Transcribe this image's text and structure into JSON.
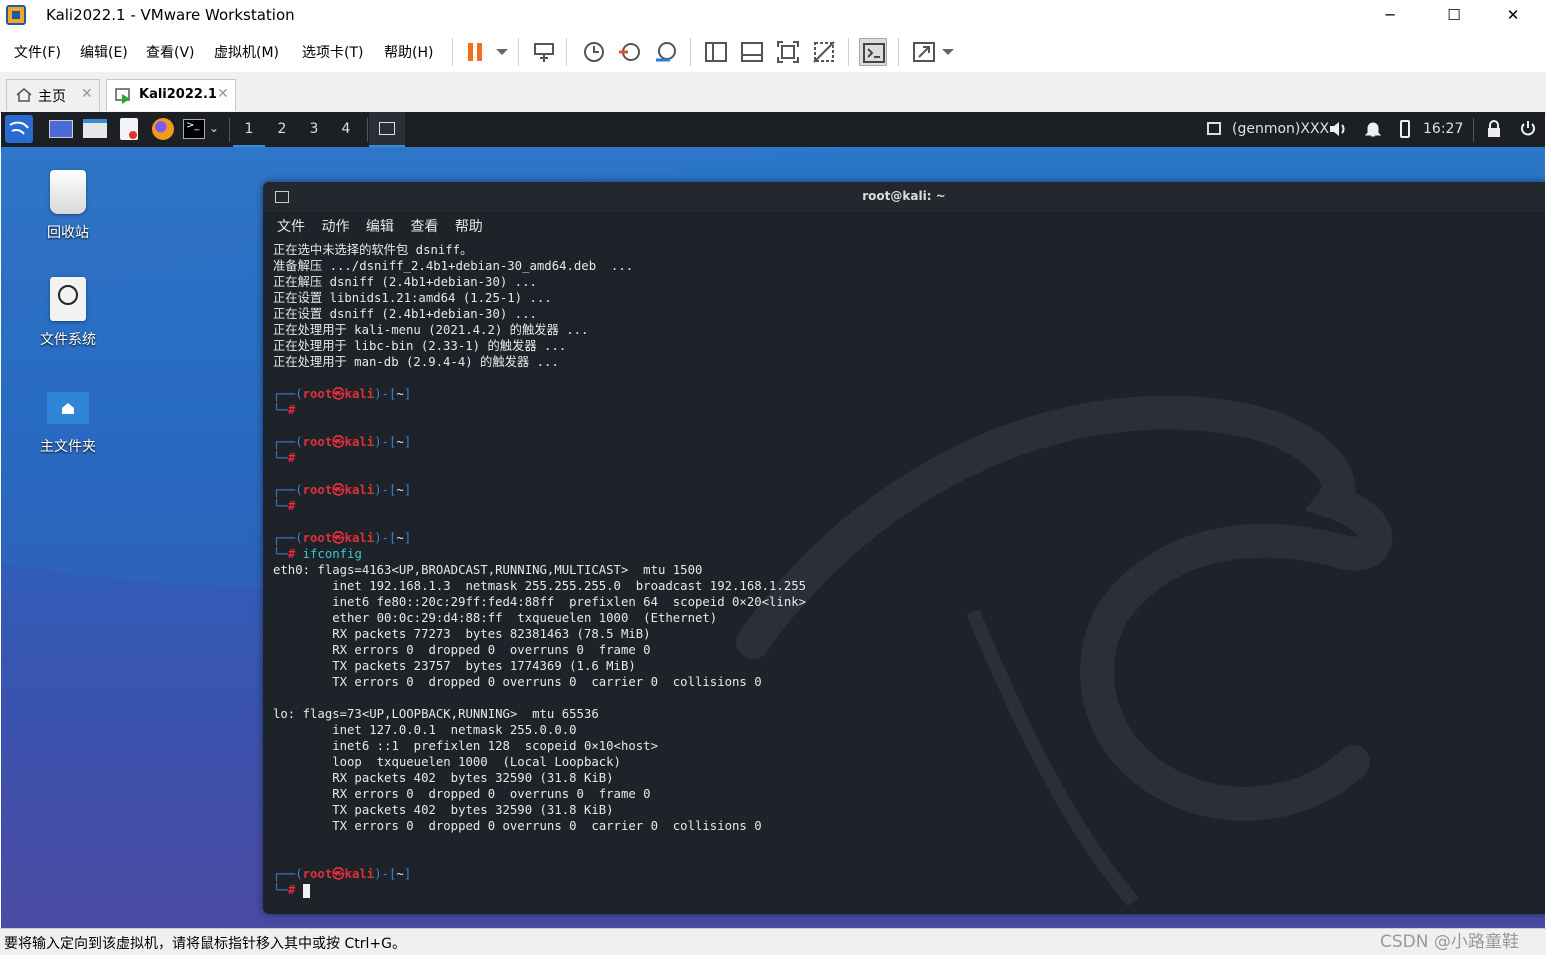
{
  "window": {
    "title": "Kali2022.1 - VMware Workstation",
    "min": "─",
    "max": "☐",
    "close": "✕"
  },
  "menu": [
    "文件(F)",
    "编辑(E)",
    "查看(V)",
    "虚拟机(M)",
    "选项卡(T)",
    "帮助(H)"
  ],
  "tabs": [
    {
      "label": "主页",
      "close": "✕"
    },
    {
      "label": "Kali2022.1",
      "close": "✕"
    }
  ],
  "kali_panel": {
    "workspaces": [
      "1",
      "2",
      "3",
      "4"
    ],
    "genmon": "(genmon)XXX",
    "clock": "16:27"
  },
  "desktop_icons": [
    "回收站",
    "文件系统",
    "主文件夹"
  ],
  "terminal": {
    "title": "root@kali: ~",
    "menu": [
      "文件",
      "动作",
      "编辑",
      "查看",
      "帮助"
    ],
    "prompt_user": "root",
    "prompt_at": "㉿",
    "prompt_host": "kali",
    "prompt_dir": "~",
    "prompt_sym": "#",
    "command": "ifconfig",
    "pre_lines": [
      "正在选中未选择的软件包 dsniff。",
      "准备解压 .../dsniff_2.4b1+debian-30_amd64.deb  ...",
      "正在解压 dsniff (2.4b1+debian-30) ...",
      "正在设置 libnids1.21:amd64 (1.25-1) ...",
      "正在设置 dsniff (2.4b1+debian-30) ...",
      "正在处理用于 kali-menu (2021.4.2) 的触发器 ...",
      "正在处理用于 libc-bin (2.33-1) 的触发器 ...",
      "正在处理用于 man-db (2.9.4-4) 的触发器 ..."
    ],
    "output_lines": [
      "eth0: flags=4163<UP,BROADCAST,RUNNING,MULTICAST>  mtu 1500",
      "        inet 192.168.1.3  netmask 255.255.255.0  broadcast 192.168.1.255",
      "        inet6 fe80::20c:29ff:fed4:88ff  prefixlen 64  scopeid 0×20<link>",
      "        ether 00:0c:29:d4:88:ff  txqueuelen 1000  (Ethernet)",
      "        RX packets 77273  bytes 82381463 (78.5 MiB)",
      "        RX errors 0  dropped 0  overruns 0  frame 0",
      "        TX packets 23757  bytes 1774369 (1.6 MiB)",
      "        TX errors 0  dropped 0 overruns 0  carrier 0  collisions 0",
      "",
      "lo: flags=73<UP,LOOPBACK,RUNNING>  mtu 65536",
      "        inet 127.0.0.1  netmask 255.0.0.0",
      "        inet6 ::1  prefixlen 128  scopeid 0×10<host>",
      "        loop  txqueuelen 1000  (Local Loopback)",
      "        RX packets 402  bytes 32590 (31.8 KiB)",
      "        RX errors 0  dropped 0  overruns 0  frame 0",
      "        TX packets 402  bytes 32590 (31.8 KiB)",
      "        TX errors 0  dropped 0 overruns 0  carrier 0  collisions 0"
    ]
  },
  "status_bar": {
    "text": "要将输入定向到该虚拟机，请将鼠标指针移入其中或按 Ctrl+G。",
    "watermark": "CSDN @小路童鞋"
  }
}
